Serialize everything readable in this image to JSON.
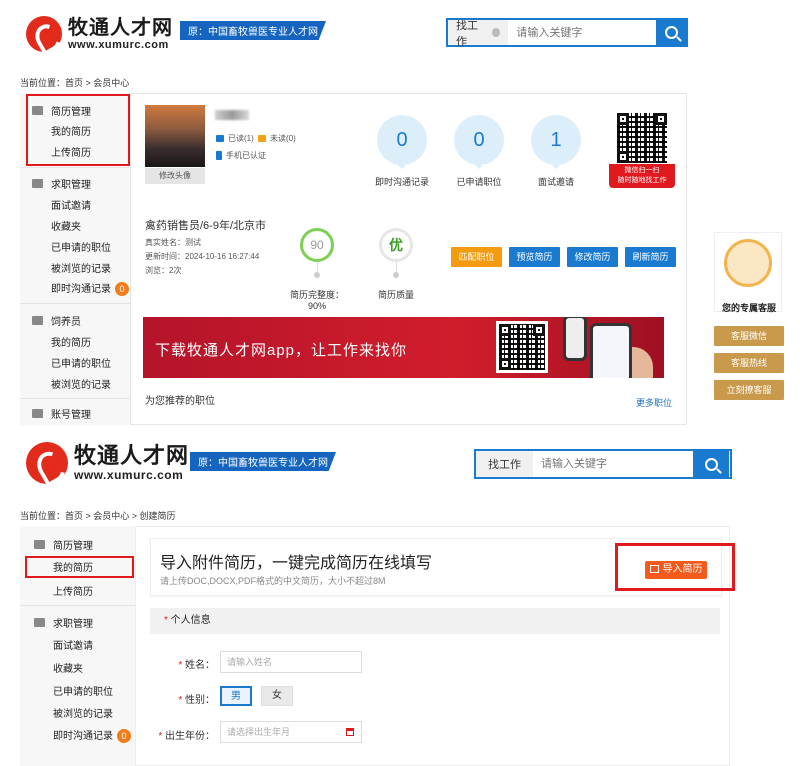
{
  "header": {
    "logo_cn": "牧通人才网",
    "logo_en": "www.xumurc.com",
    "slogan": "原：中国畜牧兽医专业人才网",
    "search_category": "找工作",
    "search_placeholder": "请输入关键字"
  },
  "panel1": {
    "breadcrumb": "当前位置：首页 > 会员中心",
    "sidebar": {
      "group1_title": "简历管理",
      "group1_items": [
        "我的简历",
        "上传简历"
      ],
      "group2_title": "求职管理",
      "group2_items": [
        "面试邀请",
        "收藏夹",
        "已申请的职位",
        "被浏览的记录",
        "即时沟通记录"
      ],
      "chat_badge": "0",
      "group3_title": "饲养员",
      "group3_items": [
        "我的简历",
        "已申请的职位",
        "被浏览的记录"
      ],
      "group4_title": "账号管理"
    },
    "profile": {
      "change_avatar": "修改头像",
      "read": "已读(1)",
      "unread": "未读(0)",
      "phone_verified": "手机已认证"
    },
    "stats": [
      {
        "value": "0",
        "label": "即时沟通记录"
      },
      {
        "value": "0",
        "label": "已申请职位"
      },
      {
        "value": "1",
        "label": "面试邀请"
      }
    ],
    "wechat_tag": [
      "微信扫一扫",
      "随时随地找工作"
    ],
    "resume": {
      "job": "禽药销售员/6-9年/北京市",
      "real_name": "真实姓名：测试",
      "updated": "更新时间：2024-10-16 16:27:44",
      "views": "浏览：2次",
      "completeness_value": "90",
      "completeness_label": "简历完整度：90%",
      "quality_value": "优",
      "quality_label": "简历质量"
    },
    "buttons": {
      "match": "匹配职位",
      "preview": "预览简历",
      "edit": "修改简历",
      "refresh": "刷新简历"
    },
    "banner_text": "下载牧通人才网app，让工作来找你",
    "recommend_title": "为您推荐的职位",
    "more_link": "更多职位",
    "service": {
      "title": "您的专属客服",
      "wechat": "客服微信",
      "hotline": "客服热线",
      "contact": "立刻撩客服"
    }
  },
  "panel2": {
    "breadcrumb": "当前位置：首页 > 会员中心 > 创建简历",
    "sidebar": {
      "group1_title": "简历管理",
      "group1_items": [
        "我的简历",
        "上传简历"
      ],
      "group2_title": "求职管理",
      "group2_items": [
        "面试邀请",
        "收藏夹",
        "已申请的职位",
        "被浏览的记录",
        "即时沟通记录"
      ],
      "chat_badge": "0"
    },
    "intro_title": "导入附件简历，一键完成简历在线填写",
    "intro_sub": "请上传DOC,DOCX,PDF格式的中文简历，大小不超过8M",
    "import_button": "导入简历",
    "section_title": "个人信息",
    "form": {
      "name_label": "姓名：",
      "name_placeholder": "请输入姓名",
      "gender_label": "性别：",
      "gender_male": "男",
      "gender_female": "女",
      "birth_label": "出生年份：",
      "birth_placeholder": "请选择出生年月"
    }
  },
  "colors": {
    "brand_blue": "#1a7ad0",
    "brand_red": "#e0191f",
    "orange": "#f39c12",
    "highlight": "#e0191f"
  }
}
